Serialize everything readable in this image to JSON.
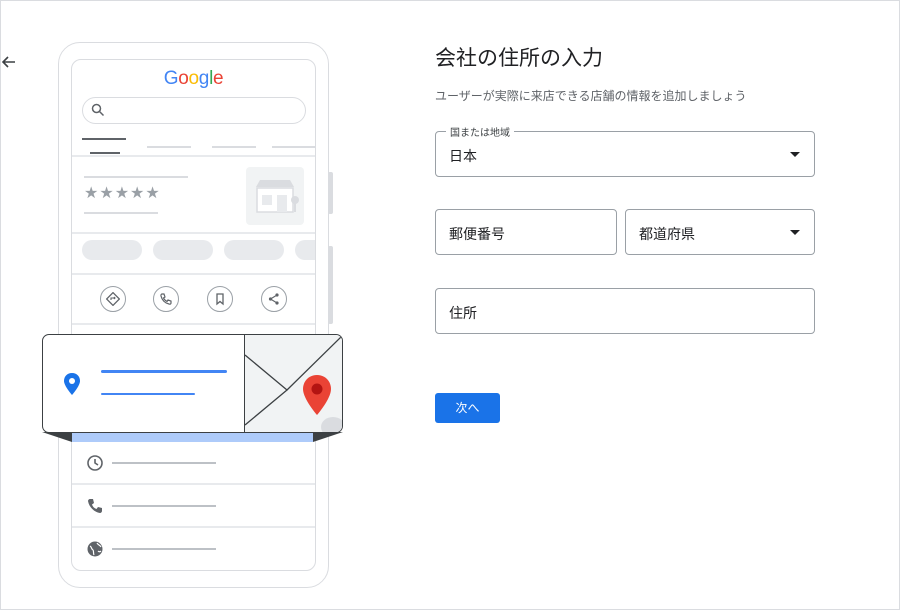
{
  "illustration": {
    "logo_text": "Google",
    "rating_stars": "★★★★★",
    "logo_colors": [
      "#4285F4",
      "#EA4335",
      "#FBBC05",
      "#4285F4",
      "#34A853",
      "#EA4335"
    ]
  },
  "form": {
    "title": "会社の住所の入力",
    "subtitle": "ユーザーが実際に来店できる店舗の情報を追加しましょう",
    "country_label": "国または地域",
    "country_value": "日本",
    "postal_placeholder": "郵便番号",
    "prefecture_placeholder": "都道府県",
    "address_placeholder": "住所",
    "next_label": "次へ"
  },
  "colors": {
    "accent": "#1a73e8",
    "pin_red": "#ea4335",
    "pin_blue": "#1a73e8",
    "highlight": "#aecbfa"
  }
}
